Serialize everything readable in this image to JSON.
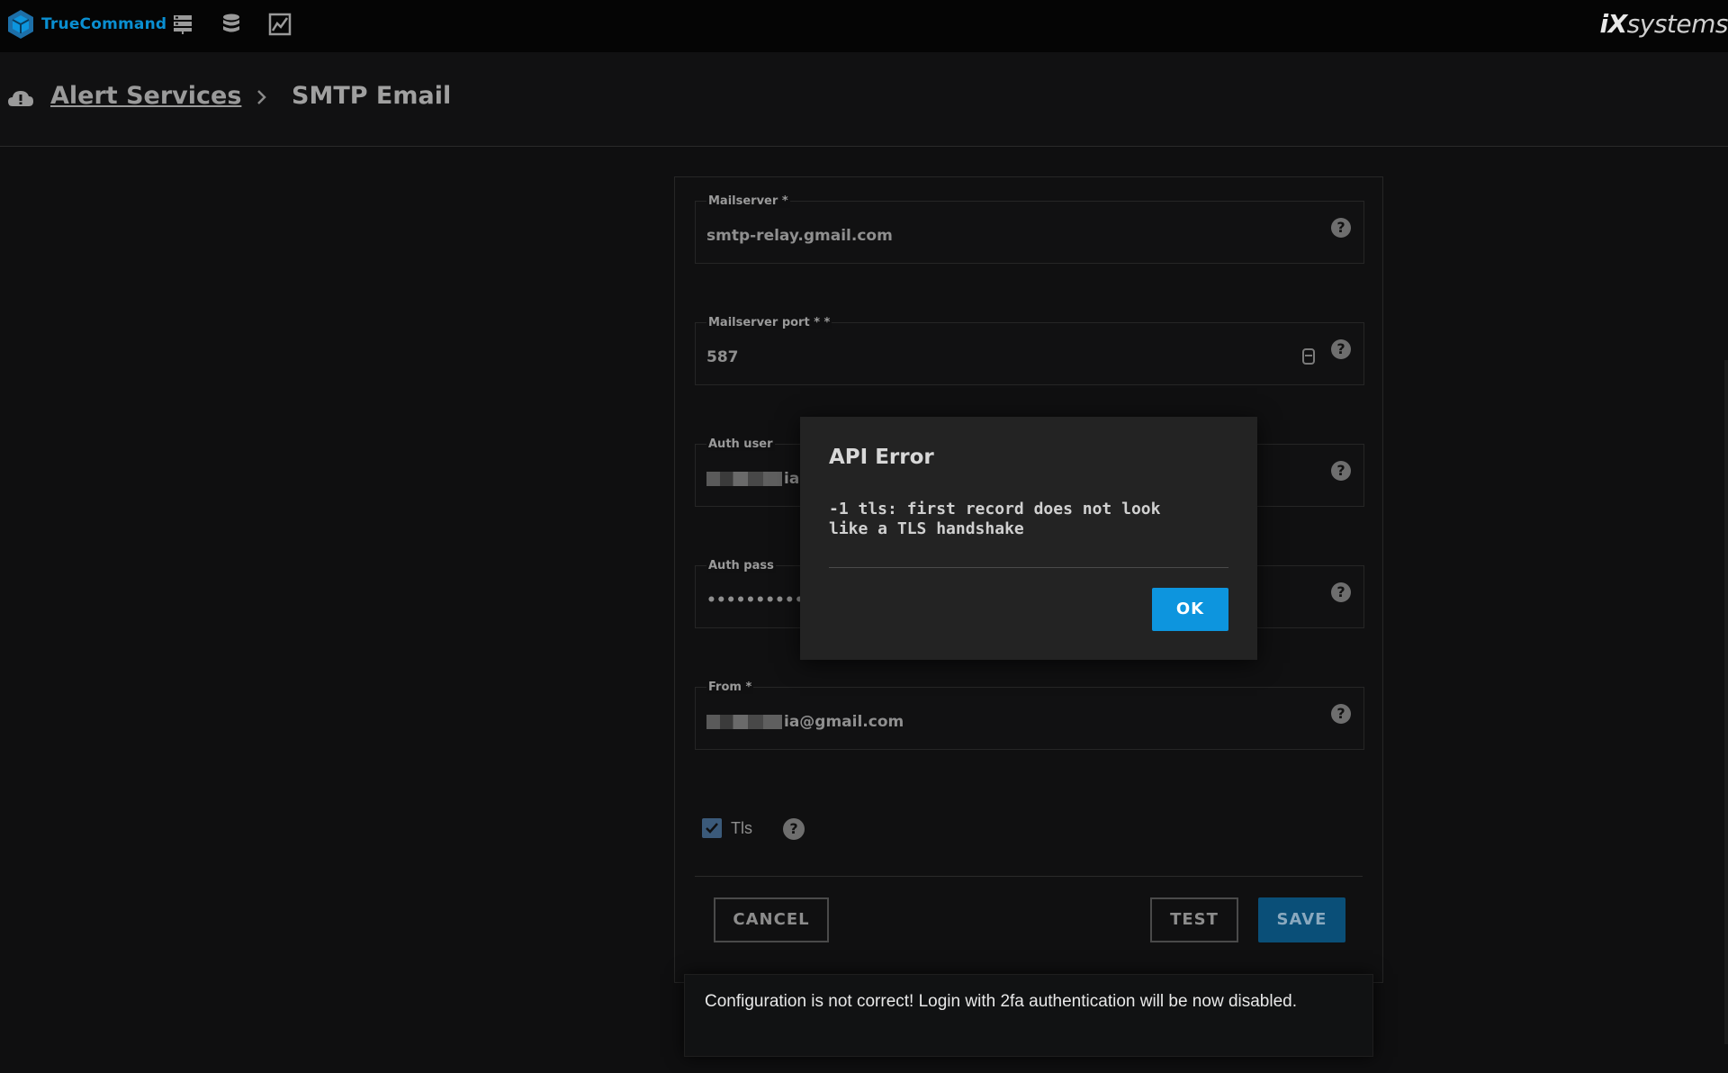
{
  "app": {
    "name": "TrueCommand",
    "vendor_mark": "iX",
    "vendor_suffix": "systems"
  },
  "nav": {
    "icons": [
      "systems-icon",
      "database-icon",
      "reports-icon"
    ]
  },
  "breadcrumb": {
    "parent": "Alert Services",
    "current": "SMTP Email"
  },
  "form": {
    "fields": [
      {
        "label": "Mailserver *",
        "value": "smtp-relay.gmail.com"
      },
      {
        "label": "Mailserver port * *",
        "value": "587"
      },
      {
        "label": "Auth user",
        "value_suffix": "ia"
      },
      {
        "label": "Auth pass",
        "value": "••••••••••"
      },
      {
        "label": "From *",
        "value_suffix": "ia@gmail.com"
      }
    ],
    "tls_label": "Tls",
    "tls_checked": true,
    "help_glyph": "?",
    "buttons": {
      "cancel": "CANCEL",
      "test": "TEST",
      "save": "SAVE"
    }
  },
  "dialog": {
    "title": "API Error",
    "message": "-1 tls: first record does not look like a TLS handshake",
    "ok": "OK"
  },
  "toast": {
    "message": "Configuration is not correct! Login with 2fa authentication will be now disabled."
  },
  "colors": {
    "accent": "#0d95de",
    "save": "#0a4f78",
    "brand": "#0a8fd1"
  }
}
